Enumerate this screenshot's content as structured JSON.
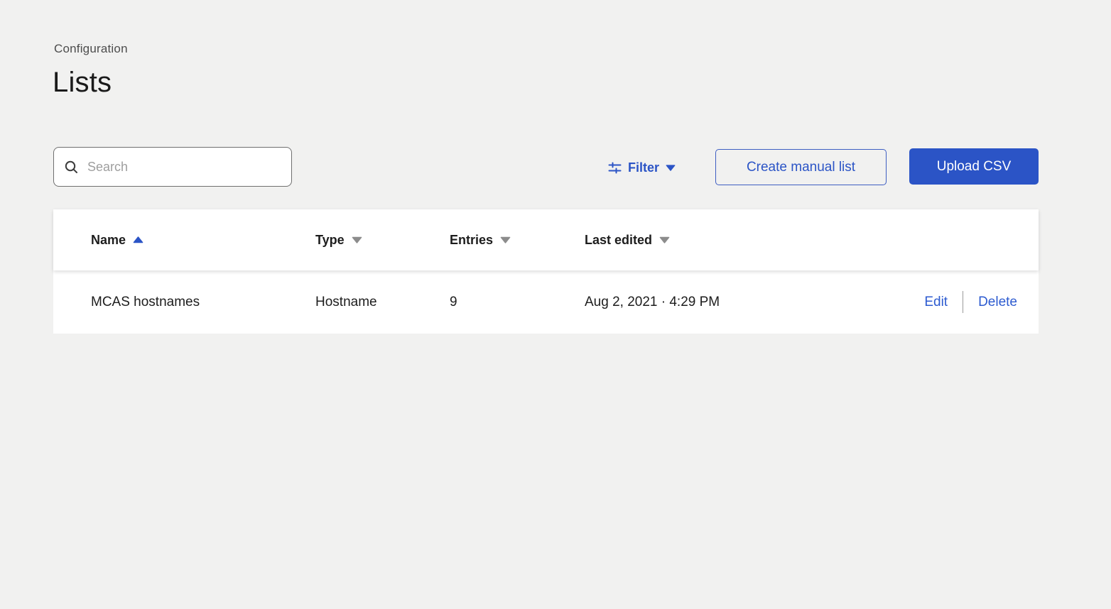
{
  "page": {
    "eyebrow": "Configuration",
    "title": "Lists"
  },
  "toolbar": {
    "search_placeholder": "Search",
    "search_value": "",
    "filter_label": "Filter",
    "create_manual_list_label": "Create manual list",
    "upload_csv_label": "Upload CSV"
  },
  "table": {
    "columns": [
      {
        "label": "Name",
        "sort": "asc",
        "sort_icon": "sort-asc-icon"
      },
      {
        "label": "Type",
        "sort": "none",
        "sort_icon": "caret-down-icon"
      },
      {
        "label": "Entries",
        "sort": "none",
        "sort_icon": "caret-down-icon"
      },
      {
        "label": "Last edited",
        "sort": "none",
        "sort_icon": "caret-down-icon"
      }
    ],
    "rows": [
      {
        "name": "MCAS hostnames",
        "type": "Hostname",
        "entries": "9",
        "last_edited": "Aug 2, 2021 · 4:29 PM",
        "actions": {
          "edit": "Edit",
          "delete": "Delete"
        }
      }
    ]
  },
  "icons": {
    "search": "search-icon",
    "filter": "filter-sliders-icon",
    "filter_caret": "caret-down-icon",
    "sort_ascending": "sort-asc-icon",
    "sort_inactive": "caret-down-icon"
  },
  "colors": {
    "accent_blue": "#2B54C6",
    "link_blue": "#2D5BD0",
    "page_background": "#F1F1F0",
    "surface_white": "#FFFFFF",
    "text_primary": "#1D1D1D",
    "text_secondary": "#4D4D4D",
    "sort_inactive_gray": "#8C8C8C",
    "search_border": "#6F6F6F"
  }
}
